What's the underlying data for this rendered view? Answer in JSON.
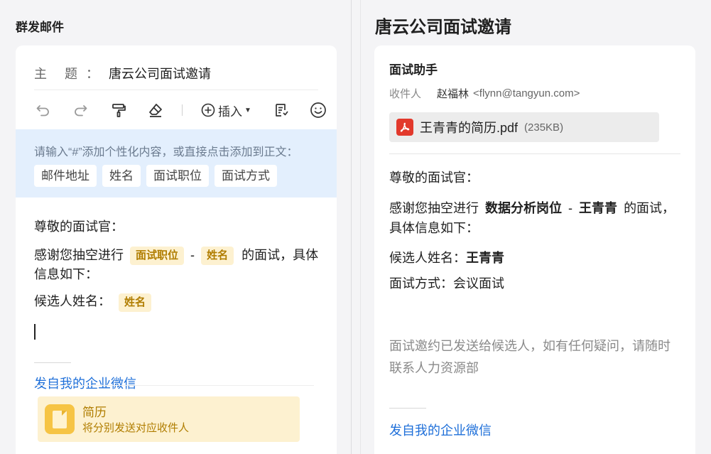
{
  "compose": {
    "panel_title": "群发邮件",
    "subject_label": "主 题",
    "subject_colon": "：",
    "subject_value": "唐云公司面试邀请",
    "toolbar": {
      "undo_icon": "undo-icon",
      "redo_icon": "redo-icon",
      "format_painter_icon": "format-painter-icon",
      "eraser_icon": "eraser-icon",
      "insert_label": "插入",
      "template_icon": "template-icon",
      "emoji_icon": "emoji-icon"
    },
    "placeholder_hint": "请输入“#”添加个性化内容，或直接点击添加到正文：",
    "placeholder_chips": [
      "邮件地址",
      "姓名",
      "面试职位",
      "面试方式"
    ],
    "body": {
      "greeting": "尊敬的面试官：",
      "line2_prefix": "感谢您抽空进行",
      "tag_position": "面试职位",
      "dash": "-",
      "tag_name": "姓名",
      "line2_suffix": "的面试，具体",
      "line3": "信息如下：",
      "line4_prefix": "候选人姓名：",
      "tag_name2": "姓名"
    },
    "signature": "发自我的企业微信",
    "attachment": {
      "name": "简历",
      "description": "将分别发送对应收件人"
    }
  },
  "preview": {
    "panel_title": "唐云公司面试邀请",
    "sender": "面试助手",
    "recipient_label": "收件人",
    "recipient_name": "赵福林",
    "recipient_email": "<flynn@tangyun.com>",
    "file_name": "王青青的简历.pdf",
    "file_size": "(235KB)",
    "body": {
      "greeting": "尊敬的面试官：",
      "line2_prefix": "感谢您抽空进行",
      "position": "数据分析岗位",
      "dash": "-",
      "name": "王青青",
      "line2_suffix": "的面试，",
      "line3": "具体信息如下：",
      "candidate_label": "候选人姓名：",
      "candidate_name": "王青青",
      "method_label": "面试方式：",
      "method_value": "会议面试"
    },
    "note": "面试邀约已发送给候选人，如有任何疑问，请随时联系人力资源部",
    "signature": "发自我的企业微信"
  },
  "colors": {
    "accent_blue": "#1e6fd9",
    "tag_bg": "#fdf1d0",
    "tag_text": "#b07d00",
    "placeholder_panel": "#e3effd",
    "pdf_red": "#e2392c"
  }
}
